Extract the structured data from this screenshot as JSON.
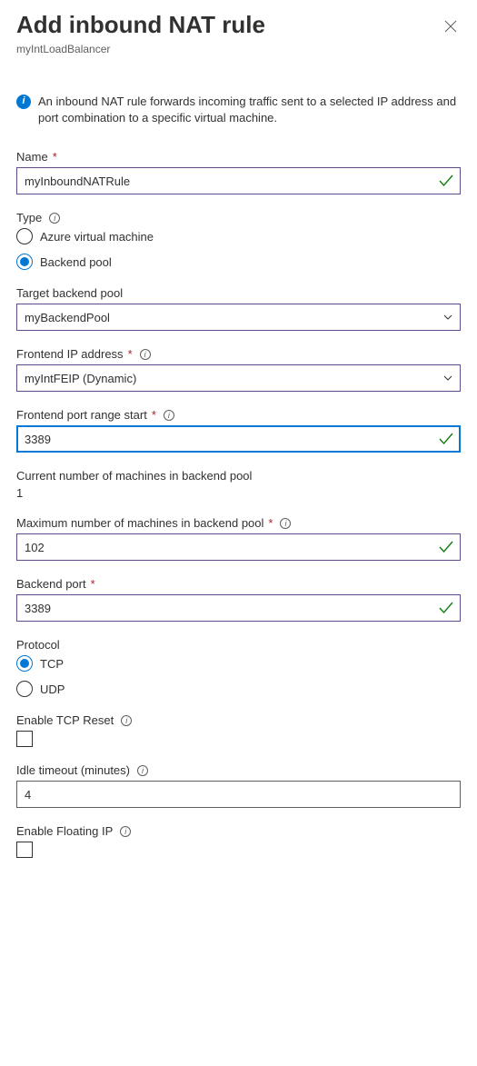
{
  "header": {
    "title": "Add inbound NAT rule",
    "subtitle": "myIntLoadBalancer"
  },
  "info": {
    "text": "An inbound NAT rule forwards incoming traffic sent to a selected IP address and port combination to a specific virtual machine."
  },
  "fields": {
    "name": {
      "label": "Name",
      "value": "myInboundNATRule"
    },
    "type": {
      "label": "Type",
      "options": {
        "avm": "Azure virtual machine",
        "bp": "Backend pool"
      },
      "selected": "bp"
    },
    "targetBackendPool": {
      "label": "Target backend pool",
      "value": "myBackendPool"
    },
    "frontendIp": {
      "label": "Frontend IP address",
      "value": "myIntFEIP (Dynamic)"
    },
    "frontendPortStart": {
      "label": "Frontend port range start",
      "value": "3389"
    },
    "currentMachines": {
      "label": "Current number of machines in backend pool",
      "value": "1"
    },
    "maxMachines": {
      "label": "Maximum number of machines in backend pool",
      "value": "102"
    },
    "backendPort": {
      "label": "Backend port",
      "value": "3389"
    },
    "protocol": {
      "label": "Protocol",
      "options": {
        "tcp": "TCP",
        "udp": "UDP"
      },
      "selected": "tcp"
    },
    "tcpReset": {
      "label": "Enable TCP Reset",
      "checked": false
    },
    "idleTimeout": {
      "label": "Idle timeout (minutes)",
      "value": "4"
    },
    "floatingIp": {
      "label": "Enable Floating IP",
      "checked": false
    }
  }
}
